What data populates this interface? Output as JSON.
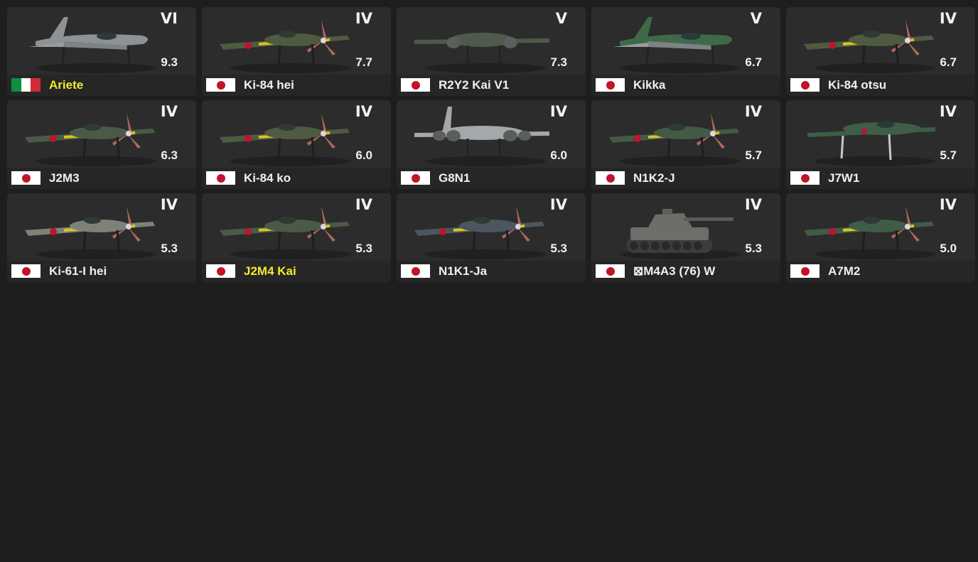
{
  "vehicles": [
    {
      "rank": "VI",
      "br": "9.3",
      "name": "Ariete",
      "nation": "italy",
      "highlight": true,
      "kind": "jet",
      "accent": "#8f9294"
    },
    {
      "rank": "IV",
      "br": "7.7",
      "name": "Ki-84 hei",
      "nation": "japan",
      "highlight": false,
      "kind": "prop",
      "accent": "#4e5b41"
    },
    {
      "rank": "V",
      "br": "7.3",
      "name": "R2Y2 Kai V1",
      "nation": "japan",
      "highlight": false,
      "kind": "twin",
      "accent": "#4f5a4c"
    },
    {
      "rank": "V",
      "br": "6.7",
      "name": "Kikka",
      "nation": "japan",
      "highlight": false,
      "kind": "jet",
      "accent": "#3f6a4a"
    },
    {
      "rank": "IV",
      "br": "6.7",
      "name": "Ki-84 otsu",
      "nation": "japan",
      "highlight": false,
      "kind": "prop",
      "accent": "#4e5b41"
    },
    {
      "rank": "IV",
      "br": "6.3",
      "name": "J2M3",
      "nation": "japan",
      "highlight": false,
      "kind": "prop",
      "accent": "#4a5a46"
    },
    {
      "rank": "IV",
      "br": "6.0",
      "name": "Ki-84 ko",
      "nation": "japan",
      "highlight": false,
      "kind": "prop",
      "accent": "#4e5b41"
    },
    {
      "rank": "IV",
      "br": "6.0",
      "name": "G8N1",
      "nation": "japan",
      "highlight": false,
      "kind": "bomber",
      "accent": "#a3a6a8"
    },
    {
      "rank": "IV",
      "br": "5.7",
      "name": "N1K2-J",
      "nation": "japan",
      "highlight": false,
      "kind": "prop",
      "accent": "#425a46"
    },
    {
      "rank": "IV",
      "br": "5.7",
      "name": "J7W1",
      "nation": "japan",
      "highlight": false,
      "kind": "canard",
      "accent": "#3f5d47"
    },
    {
      "rank": "IV",
      "br": "5.3",
      "name": "Ki-61-I hei",
      "nation": "japan",
      "highlight": false,
      "kind": "prop",
      "accent": "#7d8279"
    },
    {
      "rank": "IV",
      "br": "5.3",
      "name": "J2M4 Kai",
      "nation": "japan",
      "highlight": true,
      "kind": "prop",
      "accent": "#4a5a46"
    },
    {
      "rank": "IV",
      "br": "5.3",
      "name": "N1K1-Ja",
      "nation": "japan",
      "highlight": false,
      "kind": "prop",
      "accent": "#4c5560"
    },
    {
      "rank": "IV",
      "br": "5.3",
      "name": "⊠M4A3 (76) W",
      "nation": "japan",
      "highlight": false,
      "kind": "tank",
      "accent": "#6d6d69"
    },
    {
      "rank": "IV",
      "br": "5.0",
      "name": "A7M2",
      "nation": "japan",
      "highlight": false,
      "kind": "prop",
      "accent": "#3f5c46"
    }
  ],
  "colors": {
    "highlight": "#f2ec2c",
    "text": "#f0f0f0",
    "card": "#2c2c2c",
    "background": "#1e1e1e",
    "propeller": "#b0685c",
    "wing_stripe": "#d8c422",
    "roundel": "#c0142b"
  }
}
